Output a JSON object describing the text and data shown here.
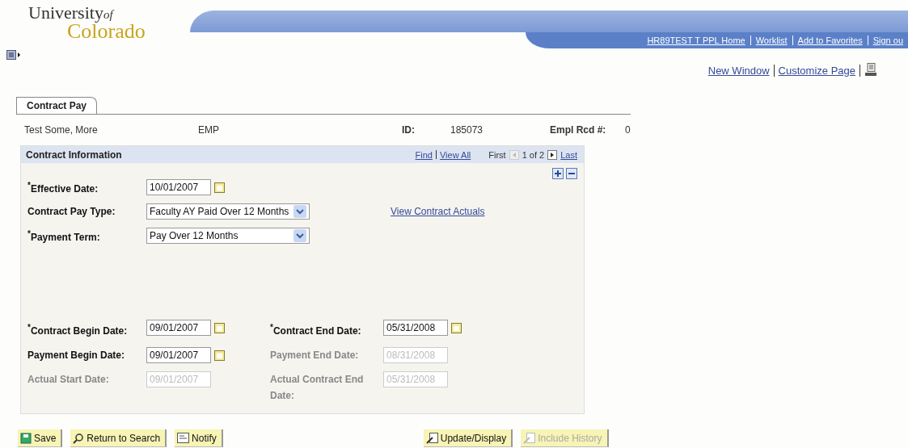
{
  "logo": {
    "line1": "University",
    "of": "of",
    "line2": "Colorado"
  },
  "header_links": [
    "HR89TEST T  PPL Home",
    "Worklist",
    "Add to Favorites",
    "Sign ou"
  ],
  "page_links": [
    "New Window",
    "Customize Page"
  ],
  "tabs": [
    {
      "label": "Contract Pay",
      "selected": true
    }
  ],
  "employee": {
    "name": "Test Some, More",
    "type": "EMP",
    "id_label": "ID:",
    "id": "185073",
    "rcd_label": "Empl Rcd #:",
    "rcd": "0"
  },
  "panel": {
    "title": "Contract Information",
    "links": [
      "Find",
      "View All"
    ],
    "first": "First",
    "count": "1 of 2",
    "last": "Last",
    "top_fields": [
      {
        "label": "$^{*}$Effective Date:",
        "kind": "date",
        "value": "10/01/2007",
        "disabled": false
      },
      {
        "label": "Contract Pay Type:",
        "kind": "select",
        "value": "Faculty AY Paid Over 12 Months",
        "disabled": false
      },
      {
        "label": "$^{*}$Payment Term:",
        "kind": "select",
        "value": "Pay Over 12 Months",
        "disabled": false
      }
    ],
    "link": "View Contract Actuals",
    "date_rows": [
      [
        {
          "label": "$^{*}$Contract Begin Date:",
          "value": "09/01/2007",
          "disabled": false
        },
        {
          "label": "$^{*}$Contract End Date:",
          "value": "05/31/2008",
          "disabled": false
        }
      ],
      [
        {
          "label": "Payment Begin Date:",
          "value": "09/01/2007",
          "disabled": false
        },
        {
          "label": "Payment End Date:",
          "value": "08/31/2008",
          "disabled": true
        }
      ],
      [
        {
          "label": "Actual Start Date:",
          "value": "09/01/2007",
          "disabled": true
        },
        {
          "label": "Actual Contract End Date:",
          "value": "05/31/2008",
          "disabled": true
        }
      ]
    ]
  },
  "buttons_left": [
    {
      "label": "Save",
      "kind": "save",
      "disabled": false
    },
    {
      "label": "Return to Search",
      "kind": "search",
      "disabled": false
    },
    {
      "label": "Notify",
      "kind": "notify",
      "disabled": false
    }
  ],
  "buttons_right": [
    {
      "label": "Update/Display",
      "kind": "update",
      "disabled": false
    },
    {
      "label": "Include History",
      "kind": "update",
      "disabled": true
    }
  ]
}
